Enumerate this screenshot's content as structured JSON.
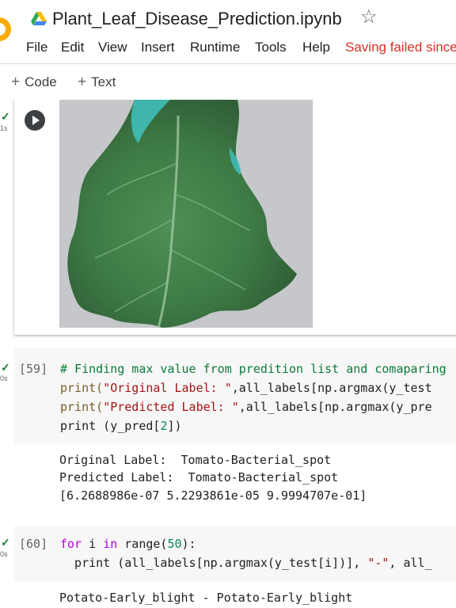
{
  "header": {
    "title": "Plant_Leaf_Disease_Prediction.ipynb",
    "menu": [
      "File",
      "Edit",
      "View",
      "Insert",
      "Runtime",
      "Tools",
      "Help"
    ],
    "saving_status": "Saving failed since",
    "icons": [
      "colab-logo",
      "google-drive-icon",
      "star-icon"
    ]
  },
  "toolbar": {
    "add_code": "Code",
    "add_text": "Text"
  },
  "cells": [
    {
      "exec_time": "1s",
      "output_image": "tomato-leaf-photo"
    },
    {
      "count": "[59]",
      "exec_time": "0s",
      "code": {
        "l1": "# Finding max value from predition list and comaparing",
        "l2a": "print(",
        "l2b": "\"Original Label: \"",
        "l2c": ",all_labels[np.argmax(y_test",
        "l3a": "print(",
        "l3b": "\"Predicted Label: \"",
        "l3c": ",all_labels[np.argmax(y_pre",
        "l4a": "print (y_pred[",
        "l4b": "2",
        "l4c": "])"
      },
      "output": [
        "Original Label:  Tomato-Bacterial_spot",
        "Predicted Label:  Tomato-Bacterial_spot",
        "[6.2688986e-07 5.2293861e-05 9.9994707e-01]"
      ]
    },
    {
      "count": "[60]",
      "exec_time": "0s",
      "code": {
        "l1a": "for",
        "l1b": " i ",
        "l1c": "in",
        "l1d": " range(",
        "l1e": "50",
        "l1f": "):",
        "l2a": "  print (all_labels[np.argmax(y_test[i])], ",
        "l2b": "\"-\"",
        "l2c": ", all_"
      },
      "output": [
        "Potato-Early_blight - Potato-Early_blight"
      ]
    }
  ]
}
